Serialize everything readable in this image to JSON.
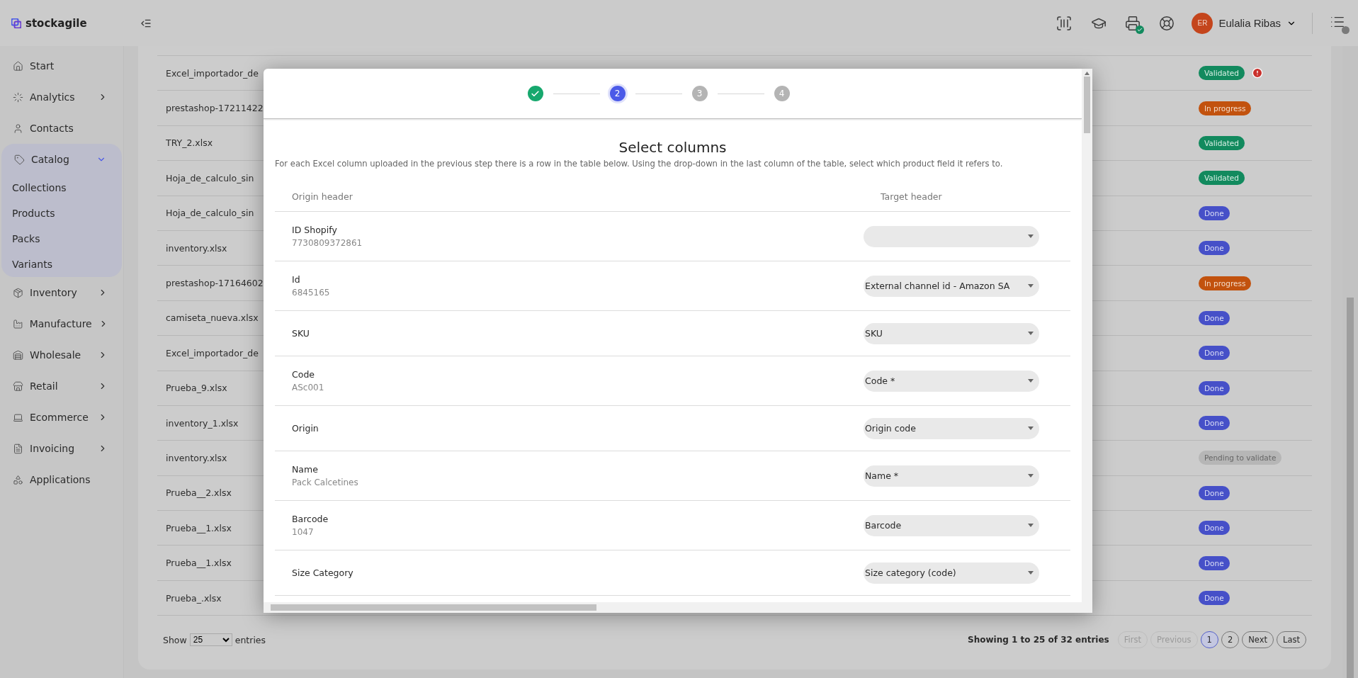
{
  "topbar": {
    "brand": "stockagile",
    "user": {
      "initials": "ER",
      "name": "Eulalia Ribas"
    }
  },
  "sidebar": {
    "items": [
      {
        "label": "Start",
        "kind": "link"
      },
      {
        "label": "Analytics",
        "kind": "group",
        "expanded": false
      },
      {
        "label": "Contacts",
        "kind": "link"
      },
      {
        "label": "Catalog",
        "kind": "group",
        "expanded": true,
        "children": [
          {
            "label": "Collections"
          },
          {
            "label": "Products"
          },
          {
            "label": "Packs"
          },
          {
            "label": "Variants"
          }
        ]
      },
      {
        "label": "Inventory",
        "kind": "group",
        "expanded": false
      },
      {
        "label": "Manufacture",
        "kind": "group",
        "expanded": false
      },
      {
        "label": "Wholesale",
        "kind": "group",
        "expanded": false
      },
      {
        "label": "Retail",
        "kind": "group",
        "expanded": false
      },
      {
        "label": "Ecommerce",
        "kind": "group",
        "expanded": false
      },
      {
        "label": "Invoicing",
        "kind": "group",
        "expanded": false
      },
      {
        "label": "Applications",
        "kind": "link"
      }
    ]
  },
  "imports": {
    "rows": [
      {
        "file": "Excel_importador_de",
        "status": "Validated",
        "kind": "validated",
        "warning": true
      },
      {
        "file": "prestashop-17211422",
        "status": "In progress",
        "kind": "progress",
        "warning": false
      },
      {
        "file": "TRY_2.xlsx",
        "status": "Validated",
        "kind": "validated",
        "warning": false
      },
      {
        "file": "Hoja_de_calculo_sin",
        "status": "Validated",
        "kind": "validated",
        "warning": false
      },
      {
        "file": "Hoja_de_calculo_sin",
        "status": "Done",
        "kind": "done",
        "warning": false
      },
      {
        "file": "inventory.xlsx",
        "status": "Done",
        "kind": "done",
        "warning": false
      },
      {
        "file": "prestashop-17164602",
        "status": "In progress",
        "kind": "progress",
        "warning": false
      },
      {
        "file": "camiseta_nueva.xlsx",
        "status": "Done",
        "kind": "done",
        "warning": false
      },
      {
        "file": "Excel_importador_de",
        "status": "Done",
        "kind": "done",
        "warning": false
      },
      {
        "file": "Prueba_9.xlsx",
        "status": "Done",
        "kind": "done",
        "warning": false
      },
      {
        "file": "inventory_1.xlsx",
        "status": "Done",
        "kind": "done",
        "warning": false
      },
      {
        "file": "inventory.xlsx",
        "status": "Pending to validate",
        "kind": "pending",
        "warning": false
      },
      {
        "file": "Prueba__2.xlsx",
        "status": "Done",
        "kind": "done",
        "warning": false
      },
      {
        "file": "Prueba__1.xlsx",
        "status": "Done",
        "kind": "done",
        "warning": false
      },
      {
        "file": "Prueba__1.xlsx",
        "status": "Done",
        "kind": "done",
        "warning": false
      },
      {
        "file": "Prueba_.xlsx",
        "status": "Done",
        "kind": "done",
        "warning": false
      }
    ],
    "footer": {
      "show_label": "Show",
      "page_size": "25",
      "entries_label": "entries",
      "summary": "Showing 1 to 25 of 32 entries",
      "pages": [
        {
          "label": "First",
          "disabled": true,
          "selected": false
        },
        {
          "label": "Previous",
          "disabled": true,
          "selected": false
        },
        {
          "label": "1",
          "disabled": false,
          "selected": true
        },
        {
          "label": "2",
          "disabled": false,
          "selected": false
        },
        {
          "label": "Next",
          "disabled": false,
          "selected": false
        },
        {
          "label": "Last",
          "disabled": false,
          "selected": false
        }
      ]
    }
  },
  "modal": {
    "steps": [
      {
        "completed": true,
        "selected": false
      },
      {
        "label": "2",
        "completed": false,
        "selected": true
      },
      {
        "label": "3",
        "completed": false,
        "selected": false
      },
      {
        "label": "4",
        "completed": false,
        "selected": false
      }
    ],
    "title": "Select columns",
    "description": "For each Excel column uploaded in the previous step there is a row in the table below. Using the drop-down in the last column of the table, select which product field it refers to.",
    "columns": [
      "Origin header",
      "Target header"
    ],
    "rows": [
      {
        "origin": "ID Shopify",
        "sample": "7730809372861"
      },
      {
        "origin": "Id",
        "sample": "6845165",
        "target": "External channel id - Amazon SA"
      },
      {
        "origin": "SKU",
        "target": "SKU"
      },
      {
        "origin": "Code",
        "sample": "ASc001",
        "target": "Code *"
      },
      {
        "origin": "Origin",
        "target": "Origin code"
      },
      {
        "origin": "Name",
        "sample": "Pack Calcetines",
        "target": "Name *"
      },
      {
        "origin": "Barcode",
        "sample": "1047",
        "target": "Barcode"
      },
      {
        "origin": "Size Category",
        "target": "Size category (code)"
      }
    ]
  }
}
